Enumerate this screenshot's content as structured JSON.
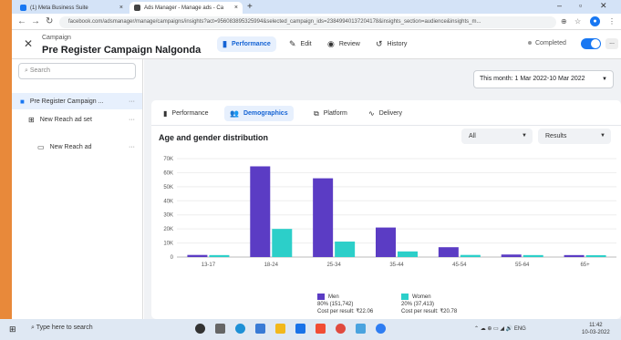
{
  "browser": {
    "tabs": [
      {
        "label": "(1) Meta Business Suite"
      },
      {
        "label": "Ads Manager - Manage ads - Ca"
      }
    ],
    "url": "facebook.com/adsmanager/manage/campaigns/insights?act=956083895325994&selected_campaign_ids=23849940137204178&insights_section=audience&insights_m..."
  },
  "header": {
    "campaign_label": "Campaign",
    "campaign_name": "Pre Register Campaign Nalgonda",
    "tabs": [
      {
        "label": "Performance"
      },
      {
        "label": "Edit"
      },
      {
        "label": "Review"
      },
      {
        "label": "History"
      }
    ],
    "status": "Completed",
    "more_label": "..."
  },
  "sidebar": {
    "search_placeholder": "Search",
    "items": [
      {
        "label": "Pre Register Campaign ..."
      },
      {
        "label": "New Reach ad set"
      },
      {
        "label": "New Reach ad"
      }
    ],
    "more_label": "···"
  },
  "main": {
    "date_range": "This month: 1 Mar 2022-10 Mar 2022",
    "tabs": [
      {
        "label": "Performance"
      },
      {
        "label": "Demographics"
      },
      {
        "label": "Platform"
      },
      {
        "label": "Delivery"
      }
    ],
    "chart_title": "Age and gender distribution",
    "filter_all": "All",
    "filter_results": "Results"
  },
  "colors": {
    "men": "#5b3cc4",
    "women": "#2ccfc9",
    "accent": "#1877f2"
  },
  "chart_data": {
    "type": "bar",
    "title": "Age and gender distribution",
    "categories": [
      "13-17",
      "18-24",
      "25-34",
      "35-44",
      "45-54",
      "55-64",
      "65+"
    ],
    "series": [
      {
        "name": "Men",
        "values": [
          1500,
          64500,
          56000,
          21000,
          7000,
          1800,
          1400
        ]
      },
      {
        "name": "Women",
        "values": [
          1400,
          20000,
          11000,
          4000,
          1500,
          1400,
          1300
        ]
      }
    ],
    "yticks": [
      "0",
      "10K",
      "20K",
      "30K",
      "40K",
      "50K",
      "60K",
      "70K"
    ],
    "ylim": [
      0,
      70000
    ],
    "legend": [
      {
        "name": "Men",
        "share": "80% (151,742)",
        "cost": "Cost per result: ₹22.06"
      },
      {
        "name": "Women",
        "share": "20% (37,413)",
        "cost": "Cost per result: ₹20.78"
      }
    ],
    "legend_position": "bottom"
  },
  "taskbar": {
    "search_placeholder": "Type here to search",
    "tray": "ENG",
    "time": "11:42",
    "date": "10-03-2022"
  }
}
